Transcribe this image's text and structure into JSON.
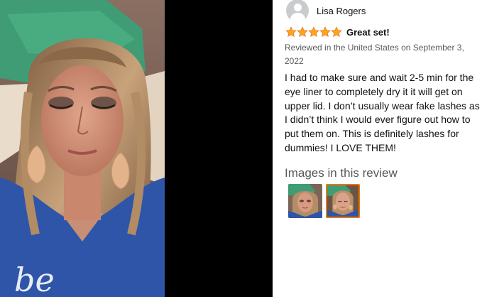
{
  "reviewer": {
    "name": "Lisa Rogers",
    "avatar_icon": "user-silhouette-icon"
  },
  "rating": {
    "stars": 5,
    "max": 5,
    "title": "Great set!",
    "star_color": "#ffa41c"
  },
  "review": {
    "date": "Reviewed in the United States on September 3, 2022",
    "body": "I had to make sure and wait 2-5 min for the eye liner to completely dry it it will get on upper lid. I don’t usually wear fake lashes as I didn’t think I would ever figure out how to put them on. This is definitely lashes for dummies! I LOVE THEM!"
  },
  "images": {
    "heading": "Images in this review",
    "thumbnails": [
      {
        "name": "review-image-1",
        "selected": false
      },
      {
        "name": "review-image-2",
        "selected": true
      }
    ],
    "selected_border_color": "#e77600"
  },
  "photo": {
    "description_icon": "review-photo-image"
  }
}
